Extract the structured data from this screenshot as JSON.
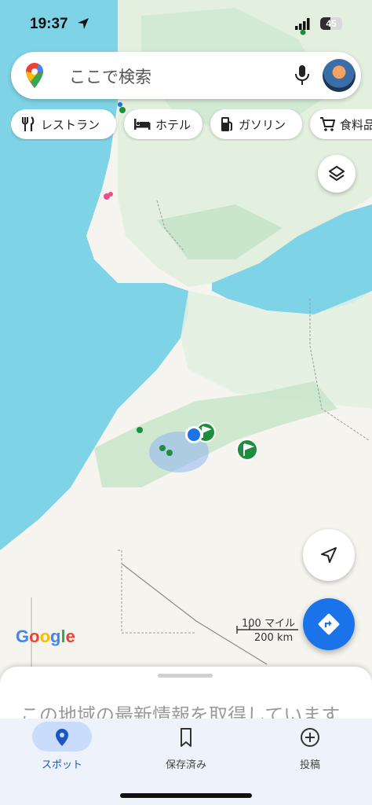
{
  "status_bar": {
    "time": "19:37",
    "battery": "45",
    "battery_fraction": 0.45,
    "icons": [
      "location-arrow-icon",
      "signal-icon",
      "battery-icon"
    ]
  },
  "search": {
    "placeholder": "ここで検索",
    "icons": [
      "maps-pin-icon",
      "mic-icon",
      "avatar"
    ]
  },
  "chips": [
    {
      "label": "レストラン",
      "icon": "fork-knife-icon"
    },
    {
      "label": "ホテル",
      "icon": "bed-icon"
    },
    {
      "label": "ガソリン",
      "icon": "gas-pump-icon"
    },
    {
      "label": "食料品",
      "icon": "cart-icon"
    }
  ],
  "map": {
    "colors": {
      "sea": "#7fd3e6",
      "land": "#f5f4ee",
      "mountain": "#bfe3c9",
      "my_location": "#1a73e8",
      "marker": "#1e8e3e"
    },
    "logo": "Google",
    "scale": {
      "imperial": "100 マイル",
      "metric": "200 km"
    }
  },
  "sheet": {
    "message": "この地域の最新情報を取得しています"
  },
  "bottom_nav": {
    "items": [
      {
        "label": "スポット",
        "icon": "pin-icon",
        "active": true
      },
      {
        "label": "保存済み",
        "icon": "bookmark-icon",
        "active": false
      },
      {
        "label": "投稿",
        "icon": "add-circle-icon",
        "active": false
      }
    ]
  }
}
